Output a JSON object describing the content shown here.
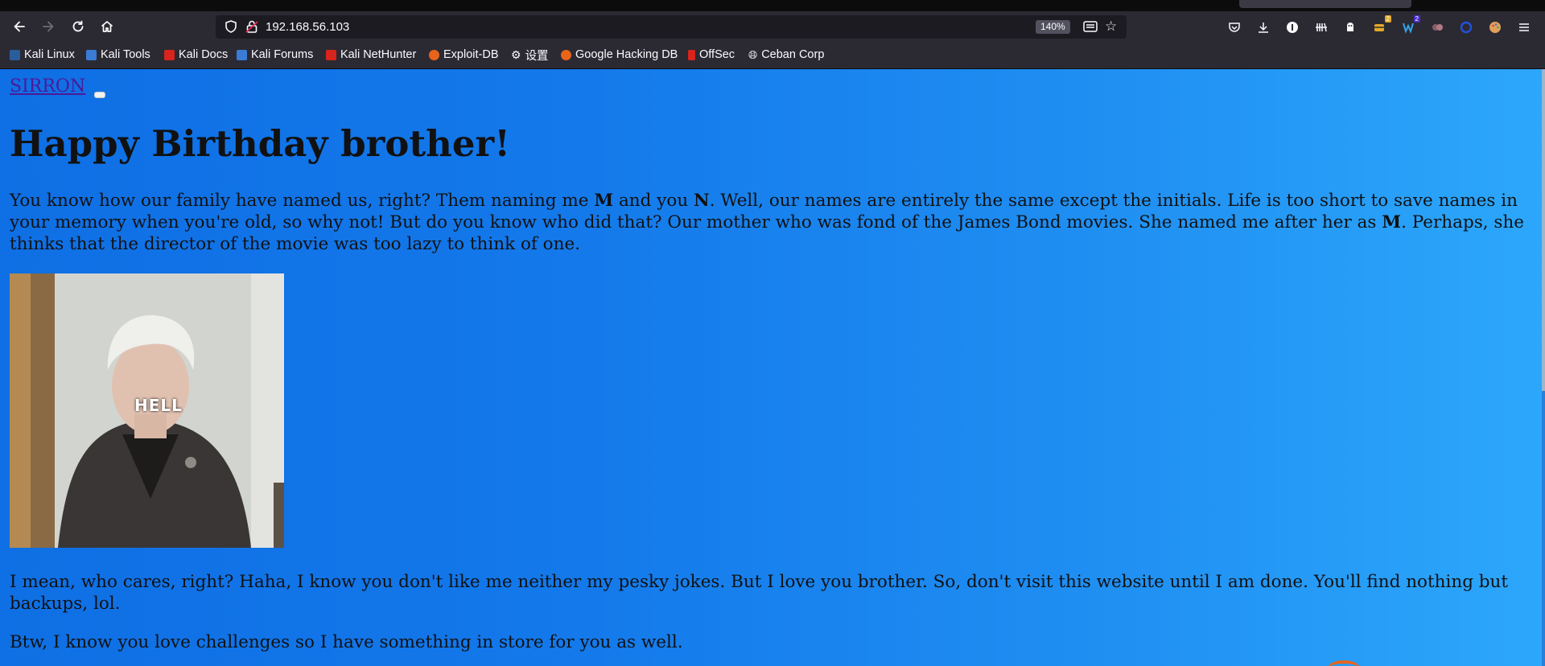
{
  "browser": {
    "url": "192.168.56.103",
    "zoom": "140%",
    "toolbar_badges": {
      "extension_a": "2",
      "extension_b": "2"
    },
    "bookmarks": [
      {
        "label": "Kali Linux",
        "color": "#2b5c9c"
      },
      {
        "label": "Kali Tools",
        "color": "#3a7bd5"
      },
      {
        "label": "Kali Docs",
        "color": "#d9231d"
      },
      {
        "label": "Kali Forums",
        "color": "#3a7bd5"
      },
      {
        "label": "Kali NetHunter",
        "color": "#d9231d"
      },
      {
        "label": "Exploit-DB",
        "color": "#e8641a"
      },
      {
        "label": "设置",
        "color": "#cfcfd8"
      },
      {
        "label": "Google Hacking DB",
        "color": "#e8641a"
      },
      {
        "label": "OffSec",
        "color": "#d9231d"
      },
      {
        "label": "Ceban Corp",
        "color": "#cfcfd8"
      }
    ]
  },
  "page": {
    "site_link": "SIRRON",
    "heading": "Happy Birthday brother!",
    "para1": {
      "t1": "You know how our family have named us, right? Them naming me ",
      "b1": "M",
      "t2": " and you ",
      "b2": "N",
      "t3": ". Well, our names are entirely the same except the initials. Life is too short to save names in your memory when you're old, so why not! But do you know who did that? Our mother who was fond of the James Bond movies. She named me after her as ",
      "b3": "M",
      "t4": ". Perhaps, she thinks that the director of the movie was too lazy to think of one."
    },
    "image_caption_text": "HELL",
    "para2": "I mean, who cares, right? Haha, I know you don't like me neither my pesky jokes. But I love you brother. So, don't visit this website until I am done. You'll find nothing but backups, lol.",
    "para3": "Btw, I know you love challenges so I have something in store for you as well."
  }
}
